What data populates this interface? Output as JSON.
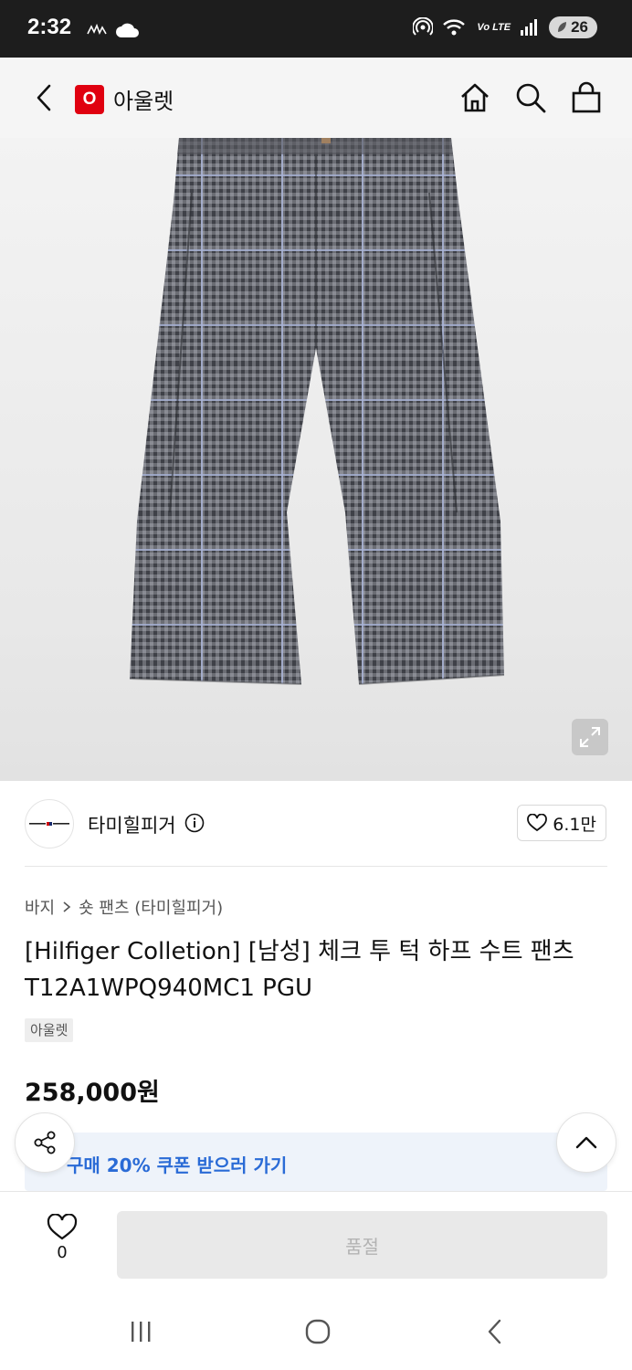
{
  "status": {
    "time": "2:32",
    "network_label": "Vo LTE",
    "battery": "26"
  },
  "header": {
    "logo_letter": "O",
    "title": "아울렛",
    "icons": [
      "back-icon",
      "home-icon",
      "search-icon",
      "shopping-bag-icon"
    ]
  },
  "image": {
    "icon": "expand-icon"
  },
  "brand": {
    "logo_text": "TOMMY HILFIGER",
    "name": "타미힐피거",
    "likes": "6.1만"
  },
  "product": {
    "breadcrumb_parent": "바지",
    "breadcrumb_child": "숏 팬츠 (타미힐피거)",
    "title_line1": "[Hilfiger Colletion] [남성] 체크 투 턱 하프 수트 팬츠",
    "title_line2": "T12A1WPQ940MC1 PGU",
    "tag": "아울렛",
    "price": "258,000원"
  },
  "coupon": {
    "text": "구매 20% 쿠폰 받으러 가기"
  },
  "bottom": {
    "wish_count": "0",
    "soldout_label": "품절"
  },
  "colors": {
    "accent_red": "#e00010",
    "coupon_blue": "#2a6bd6"
  }
}
